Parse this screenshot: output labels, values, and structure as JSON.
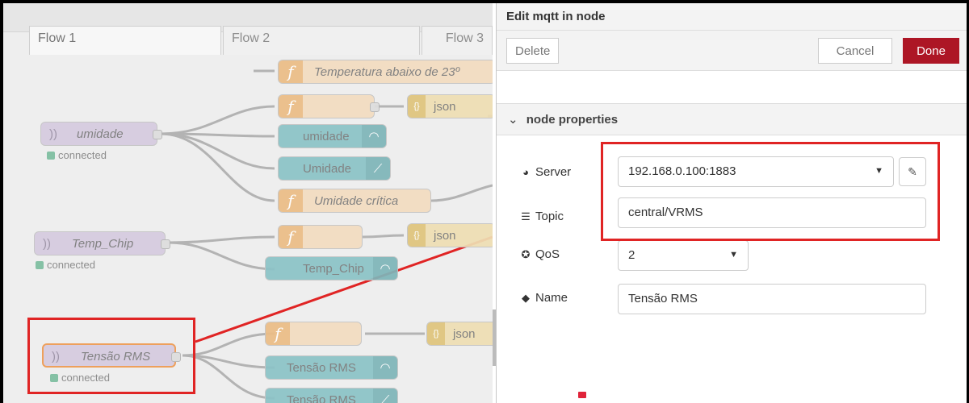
{
  "tabs": [
    "Flow 1",
    "Flow 2",
    "Flow 3"
  ],
  "nodes": {
    "func_temp_low": "Temperatura abaixo de 23º",
    "json_1": "json",
    "umidade_in": "umidade",
    "umidade_gauge": "umidade",
    "umidade_chart": "Umidade",
    "func_umid_critica": "Umidade crítica",
    "temp_chip_in": "Temp_Chip",
    "json_2": "json",
    "temp_chip_gauge": "Temp_Chip",
    "tensao_in": "Tensão RMS",
    "json_3": "json",
    "tensao_gauge": "Tensão RMS",
    "tensao_chart": "Tensão RMS"
  },
  "status_text": "connected",
  "panel": {
    "title": "Edit mqtt in node",
    "delete_label": "Delete",
    "cancel_label": "Cancel",
    "done_label": "Done",
    "section_label": "node properties",
    "server_label": "Server",
    "server_value": "192.168.0.100:1883",
    "topic_label": "Topic",
    "topic_value": "central/VRMS",
    "qos_label": "QoS",
    "qos_value": "2",
    "name_label": "Name",
    "name_value": "Tensão RMS"
  },
  "colors": {
    "done_button": "#ad1625",
    "annotation_red": "#e02424",
    "mqtt_node": "#d6cbe0",
    "function_node": "#f3dcc0",
    "dashboard_node": "#8cc3c7",
    "status_connected": "#85c1a5"
  }
}
